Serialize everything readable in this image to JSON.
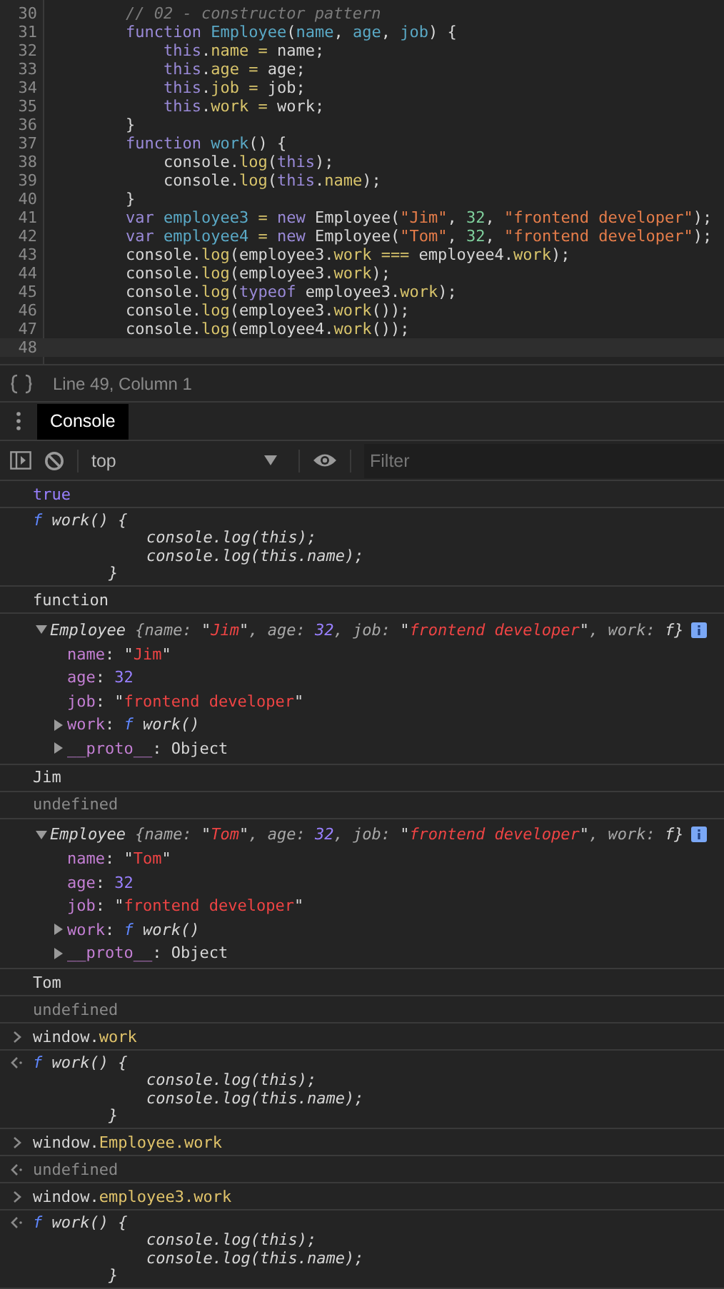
{
  "editor": {
    "lines": [
      {
        "number": "30",
        "current": false,
        "tokens": [
          {
            "text": "        // 02 - constructor pattern",
            "kind": "cm"
          }
        ]
      },
      {
        "number": "31",
        "current": false,
        "tokens": [
          {
            "text": "        function ",
            "kind": "kw"
          },
          {
            "text": "Employee",
            "kind": "def"
          },
          {
            "text": "(",
            "kind": "p"
          },
          {
            "text": "name",
            "kind": "def"
          },
          {
            "text": ", ",
            "kind": "p"
          },
          {
            "text": "age",
            "kind": "def"
          },
          {
            "text": ", ",
            "kind": "p"
          },
          {
            "text": "job",
            "kind": "def"
          },
          {
            "text": ") {",
            "kind": "p"
          }
        ]
      },
      {
        "number": "32",
        "current": false,
        "tokens": [
          {
            "text": "            this",
            "kind": "kw"
          },
          {
            "text": ".",
            "kind": "p"
          },
          {
            "text": "name =",
            "kind": "prop"
          },
          {
            "text": " name;",
            "kind": "p"
          }
        ]
      },
      {
        "number": "33",
        "current": false,
        "tokens": [
          {
            "text": "            this",
            "kind": "kw"
          },
          {
            "text": ".",
            "kind": "p"
          },
          {
            "text": "age =",
            "kind": "prop"
          },
          {
            "text": " age;",
            "kind": "p"
          }
        ]
      },
      {
        "number": "34",
        "current": false,
        "tokens": [
          {
            "text": "            this",
            "kind": "kw"
          },
          {
            "text": ".",
            "kind": "p"
          },
          {
            "text": "job =",
            "kind": "prop"
          },
          {
            "text": " job;",
            "kind": "p"
          }
        ]
      },
      {
        "number": "35",
        "current": false,
        "tokens": [
          {
            "text": "            this",
            "kind": "kw"
          },
          {
            "text": ".",
            "kind": "p"
          },
          {
            "text": "work =",
            "kind": "prop"
          },
          {
            "text": " work;",
            "kind": "p"
          }
        ]
      },
      {
        "number": "36",
        "current": false,
        "tokens": [
          {
            "text": "        }",
            "kind": "p"
          }
        ]
      },
      {
        "number": "37",
        "current": false,
        "tokens": [
          {
            "text": "        function ",
            "kind": "kw"
          },
          {
            "text": "work",
            "kind": "def"
          },
          {
            "text": "() {",
            "kind": "p"
          }
        ]
      },
      {
        "number": "38",
        "current": false,
        "tokens": [
          {
            "text": "            console.",
            "kind": "p"
          },
          {
            "text": "log",
            "kind": "prop"
          },
          {
            "text": "(",
            "kind": "p"
          },
          {
            "text": "this",
            "kind": "kw"
          },
          {
            "text": ");",
            "kind": "p"
          }
        ]
      },
      {
        "number": "39",
        "current": false,
        "tokens": [
          {
            "text": "            console.",
            "kind": "p"
          },
          {
            "text": "log",
            "kind": "prop"
          },
          {
            "text": "(",
            "kind": "p"
          },
          {
            "text": "this",
            "kind": "kw"
          },
          {
            "text": ".",
            "kind": "p"
          },
          {
            "text": "name",
            "kind": "prop"
          },
          {
            "text": ");",
            "kind": "p"
          }
        ]
      },
      {
        "number": "40",
        "current": false,
        "tokens": [
          {
            "text": "        }",
            "kind": "p"
          }
        ]
      },
      {
        "number": "41",
        "current": false,
        "tokens": [
          {
            "text": "        var ",
            "kind": "kw"
          },
          {
            "text": "employee3 ",
            "kind": "def"
          },
          {
            "text": "= ",
            "kind": "op"
          },
          {
            "text": "new",
            "kind": "kw"
          },
          {
            "text": " Employee(",
            "kind": "p"
          },
          {
            "text": "\"Jim\"",
            "kind": "str"
          },
          {
            "text": ", ",
            "kind": "p"
          },
          {
            "text": "32",
            "kind": "num"
          },
          {
            "text": ", ",
            "kind": "p"
          },
          {
            "text": "\"frontend developer\"",
            "kind": "str"
          },
          {
            "text": ");",
            "kind": "p"
          }
        ]
      },
      {
        "number": "42",
        "current": false,
        "tokens": [
          {
            "text": "        var ",
            "kind": "kw"
          },
          {
            "text": "employee4 ",
            "kind": "def"
          },
          {
            "text": "= ",
            "kind": "op"
          },
          {
            "text": "new",
            "kind": "kw"
          },
          {
            "text": " Employee(",
            "kind": "p"
          },
          {
            "text": "\"Tom\"",
            "kind": "str"
          },
          {
            "text": ", ",
            "kind": "p"
          },
          {
            "text": "32",
            "kind": "num"
          },
          {
            "text": ", ",
            "kind": "p"
          },
          {
            "text": "\"frontend developer\"",
            "kind": "str"
          },
          {
            "text": ");",
            "kind": "p"
          }
        ]
      },
      {
        "number": "43",
        "current": false,
        "tokens": [
          {
            "text": "        console.",
            "kind": "p"
          },
          {
            "text": "log",
            "kind": "prop"
          },
          {
            "text": "(employee3.",
            "kind": "p"
          },
          {
            "text": "work ===",
            "kind": "prop"
          },
          {
            "text": " employee4.",
            "kind": "p"
          },
          {
            "text": "work",
            "kind": "prop"
          },
          {
            "text": ");",
            "kind": "p"
          }
        ]
      },
      {
        "number": "44",
        "current": false,
        "tokens": [
          {
            "text": "        console.",
            "kind": "p"
          },
          {
            "text": "log",
            "kind": "prop"
          },
          {
            "text": "(employee3.",
            "kind": "p"
          },
          {
            "text": "work",
            "kind": "prop"
          },
          {
            "text": ");",
            "kind": "p"
          }
        ]
      },
      {
        "number": "45",
        "current": false,
        "tokens": [
          {
            "text": "        console.",
            "kind": "p"
          },
          {
            "text": "log",
            "kind": "prop"
          },
          {
            "text": "(",
            "kind": "p"
          },
          {
            "text": "typeof",
            "kind": "kw"
          },
          {
            "text": " employee3.",
            "kind": "p"
          },
          {
            "text": "work",
            "kind": "prop"
          },
          {
            "text": ");",
            "kind": "p"
          }
        ]
      },
      {
        "number": "46",
        "current": false,
        "tokens": [
          {
            "text": "        console.",
            "kind": "p"
          },
          {
            "text": "log",
            "kind": "prop"
          },
          {
            "text": "(employee3.",
            "kind": "p"
          },
          {
            "text": "work",
            "kind": "prop"
          },
          {
            "text": "());",
            "kind": "p"
          }
        ]
      },
      {
        "number": "47",
        "current": false,
        "tokens": [
          {
            "text": "        console.",
            "kind": "p"
          },
          {
            "text": "log",
            "kind": "prop"
          },
          {
            "text": "(employee4.",
            "kind": "p"
          },
          {
            "text": "work",
            "kind": "prop"
          },
          {
            "text": "());",
            "kind": "p"
          }
        ]
      },
      {
        "number": "48",
        "current": true
      }
    ]
  },
  "status_bar": {
    "position": "Line 49, Column 1"
  },
  "tabs": [
    {
      "label": "Console",
      "selected": true
    }
  ],
  "toolbar": {
    "context": "top",
    "filter_placeholder": "Filter"
  },
  "console": {
    "messages": [
      {
        "kind": "log",
        "lines": [
          [
            {
              "text": "true",
              "kind": "ctrue"
            }
          ]
        ]
      },
      {
        "kind": "log",
        "lines": [
          [
            {
              "text": "f",
              "kind": "fkw"
            },
            {
              "text": " work() {",
              "kind": "fn"
            }
          ],
          [
            {
              "text": "            console.log(this);",
              "kind": "fn"
            }
          ],
          [
            {
              "text": "            console.log(this.name);",
              "kind": "fn"
            }
          ],
          [
            {
              "text": "        }",
              "kind": "fn"
            }
          ]
        ]
      },
      {
        "kind": "log",
        "lines": [
          [
            {
              "text": "function",
              "kind": "p"
            }
          ]
        ]
      },
      {
        "kind": "object",
        "expanded": true,
        "summary": [
          {
            "text": "Employee",
            "kind": "cname"
          },
          {
            "text": " {name: ",
            "kind": "ci"
          },
          {
            "text": "\"",
            "kind": "q"
          },
          {
            "text": "Jim",
            "kind": "cstri"
          },
          {
            "text": "\"",
            "kind": "q"
          },
          {
            "text": ", age: ",
            "kind": "ci"
          },
          {
            "text": "32",
            "kind": "cnumi"
          },
          {
            "text": ", job: ",
            "kind": "ci"
          },
          {
            "text": "\"",
            "kind": "q"
          },
          {
            "text": "frontend developer",
            "kind": "cstri"
          },
          {
            "text": "\"",
            "kind": "q"
          },
          {
            "text": ", work: ",
            "kind": "ci"
          },
          {
            "text": "f}",
            "kind": "cname"
          }
        ],
        "properties": [
          {
            "kind": "leaf",
            "tokens": [
              {
                "text": "name",
                "kind": "ckey"
              },
              {
                "text": ": \"",
                "kind": "p"
              },
              {
                "text": "Jim",
                "kind": "cstr"
              },
              {
                "text": "\"",
                "kind": "p"
              }
            ]
          },
          {
            "kind": "leaf",
            "tokens": [
              {
                "text": "age",
                "kind": "ckey"
              },
              {
                "text": ": ",
                "kind": "p"
              },
              {
                "text": "32",
                "kind": "cnum"
              }
            ]
          },
          {
            "kind": "leaf",
            "tokens": [
              {
                "text": "job",
                "kind": "ckey"
              },
              {
                "text": ": \"",
                "kind": "p"
              },
              {
                "text": "frontend developer",
                "kind": "cstr"
              },
              {
                "text": "\"",
                "kind": "p"
              }
            ]
          },
          {
            "kind": "branch",
            "expanded": false,
            "tokens": [
              {
                "text": "work",
                "kind": "ckey"
              },
              {
                "text": ": ",
                "kind": "p"
              },
              {
                "text": "f",
                "kind": "fkw"
              },
              {
                "text": " work()",
                "kind": "fn"
              }
            ]
          },
          {
            "kind": "branch",
            "expanded": false,
            "tokens": [
              {
                "text": "__proto__",
                "kind": "ckey"
              },
              {
                "text": ": Object",
                "kind": "p"
              }
            ]
          }
        ]
      },
      {
        "kind": "log",
        "lines": [
          [
            {
              "text": "Jim",
              "kind": "p"
            }
          ]
        ]
      },
      {
        "kind": "log",
        "lines": [
          [
            {
              "text": "undefined",
              "kind": "und"
            }
          ]
        ]
      },
      {
        "kind": "object",
        "expanded": true,
        "summary": [
          {
            "text": "Employee",
            "kind": "cname"
          },
          {
            "text": " {name: ",
            "kind": "ci"
          },
          {
            "text": "\"",
            "kind": "q"
          },
          {
            "text": "Tom",
            "kind": "cstri"
          },
          {
            "text": "\"",
            "kind": "q"
          },
          {
            "text": ", age: ",
            "kind": "ci"
          },
          {
            "text": "32",
            "kind": "cnumi"
          },
          {
            "text": ", job: ",
            "kind": "ci"
          },
          {
            "text": "\"",
            "kind": "q"
          },
          {
            "text": "frontend developer",
            "kind": "cstri"
          },
          {
            "text": "\"",
            "kind": "q"
          },
          {
            "text": ", work: ",
            "kind": "ci"
          },
          {
            "text": "f}",
            "kind": "cname"
          }
        ],
        "properties": [
          {
            "kind": "leaf",
            "tokens": [
              {
                "text": "name",
                "kind": "ckey"
              },
              {
                "text": ": \"",
                "kind": "p"
              },
              {
                "text": "Tom",
                "kind": "cstr"
              },
              {
                "text": "\"",
                "kind": "p"
              }
            ]
          },
          {
            "kind": "leaf",
            "tokens": [
              {
                "text": "age",
                "kind": "ckey"
              },
              {
                "text": ": ",
                "kind": "p"
              },
              {
                "text": "32",
                "kind": "cnum"
              }
            ]
          },
          {
            "kind": "leaf",
            "tokens": [
              {
                "text": "job",
                "kind": "ckey"
              },
              {
                "text": ": \"",
                "kind": "p"
              },
              {
                "text": "frontend developer",
                "kind": "cstr"
              },
              {
                "text": "\"",
                "kind": "p"
              }
            ]
          },
          {
            "kind": "branch",
            "expanded": false,
            "tokens": [
              {
                "text": "work",
                "kind": "ckey"
              },
              {
                "text": ": ",
                "kind": "p"
              },
              {
                "text": "f",
                "kind": "fkw"
              },
              {
                "text": " work()",
                "kind": "fn"
              }
            ]
          },
          {
            "kind": "branch",
            "expanded": false,
            "tokens": [
              {
                "text": "__proto__",
                "kind": "ckey"
              },
              {
                "text": ": Object",
                "kind": "p"
              }
            ]
          }
        ]
      },
      {
        "kind": "log",
        "lines": [
          [
            {
              "text": "Tom",
              "kind": "p"
            }
          ]
        ]
      },
      {
        "kind": "log",
        "lines": [
          [
            {
              "text": "undefined",
              "kind": "und"
            }
          ]
        ]
      },
      {
        "kind": "input",
        "lines": [
          [
            {
              "text": "window.",
              "kind": "p"
            },
            {
              "text": "work",
              "kind": "cyel"
            }
          ]
        ]
      },
      {
        "kind": "result",
        "lines": [
          [
            {
              "text": "f",
              "kind": "fkw"
            },
            {
              "text": " work() {",
              "kind": "fn"
            }
          ],
          [
            {
              "text": "            console.log(this);",
              "kind": "fn"
            }
          ],
          [
            {
              "text": "            console.log(this.name);",
              "kind": "fn"
            }
          ],
          [
            {
              "text": "        }",
              "kind": "fn"
            }
          ]
        ]
      },
      {
        "kind": "input",
        "lines": [
          [
            {
              "text": "window.",
              "kind": "p"
            },
            {
              "text": "Employee.work",
              "kind": "cyel"
            }
          ]
        ]
      },
      {
        "kind": "result",
        "lines": [
          [
            {
              "text": "undefined",
              "kind": "und"
            }
          ]
        ]
      },
      {
        "kind": "input",
        "lines": [
          [
            {
              "text": "window.",
              "kind": "p"
            },
            {
              "text": "employee3.work",
              "kind": "cyel"
            }
          ]
        ]
      },
      {
        "kind": "result",
        "lines": [
          [
            {
              "text": "f",
              "kind": "fkw"
            },
            {
              "text": " work() {",
              "kind": "fn"
            }
          ],
          [
            {
              "text": "            console.log(this);",
              "kind": "fn"
            }
          ],
          [
            {
              "text": "            console.log(this.name);",
              "kind": "fn"
            }
          ],
          [
            {
              "text": "        }",
              "kind": "fn"
            }
          ]
        ]
      }
    ]
  }
}
